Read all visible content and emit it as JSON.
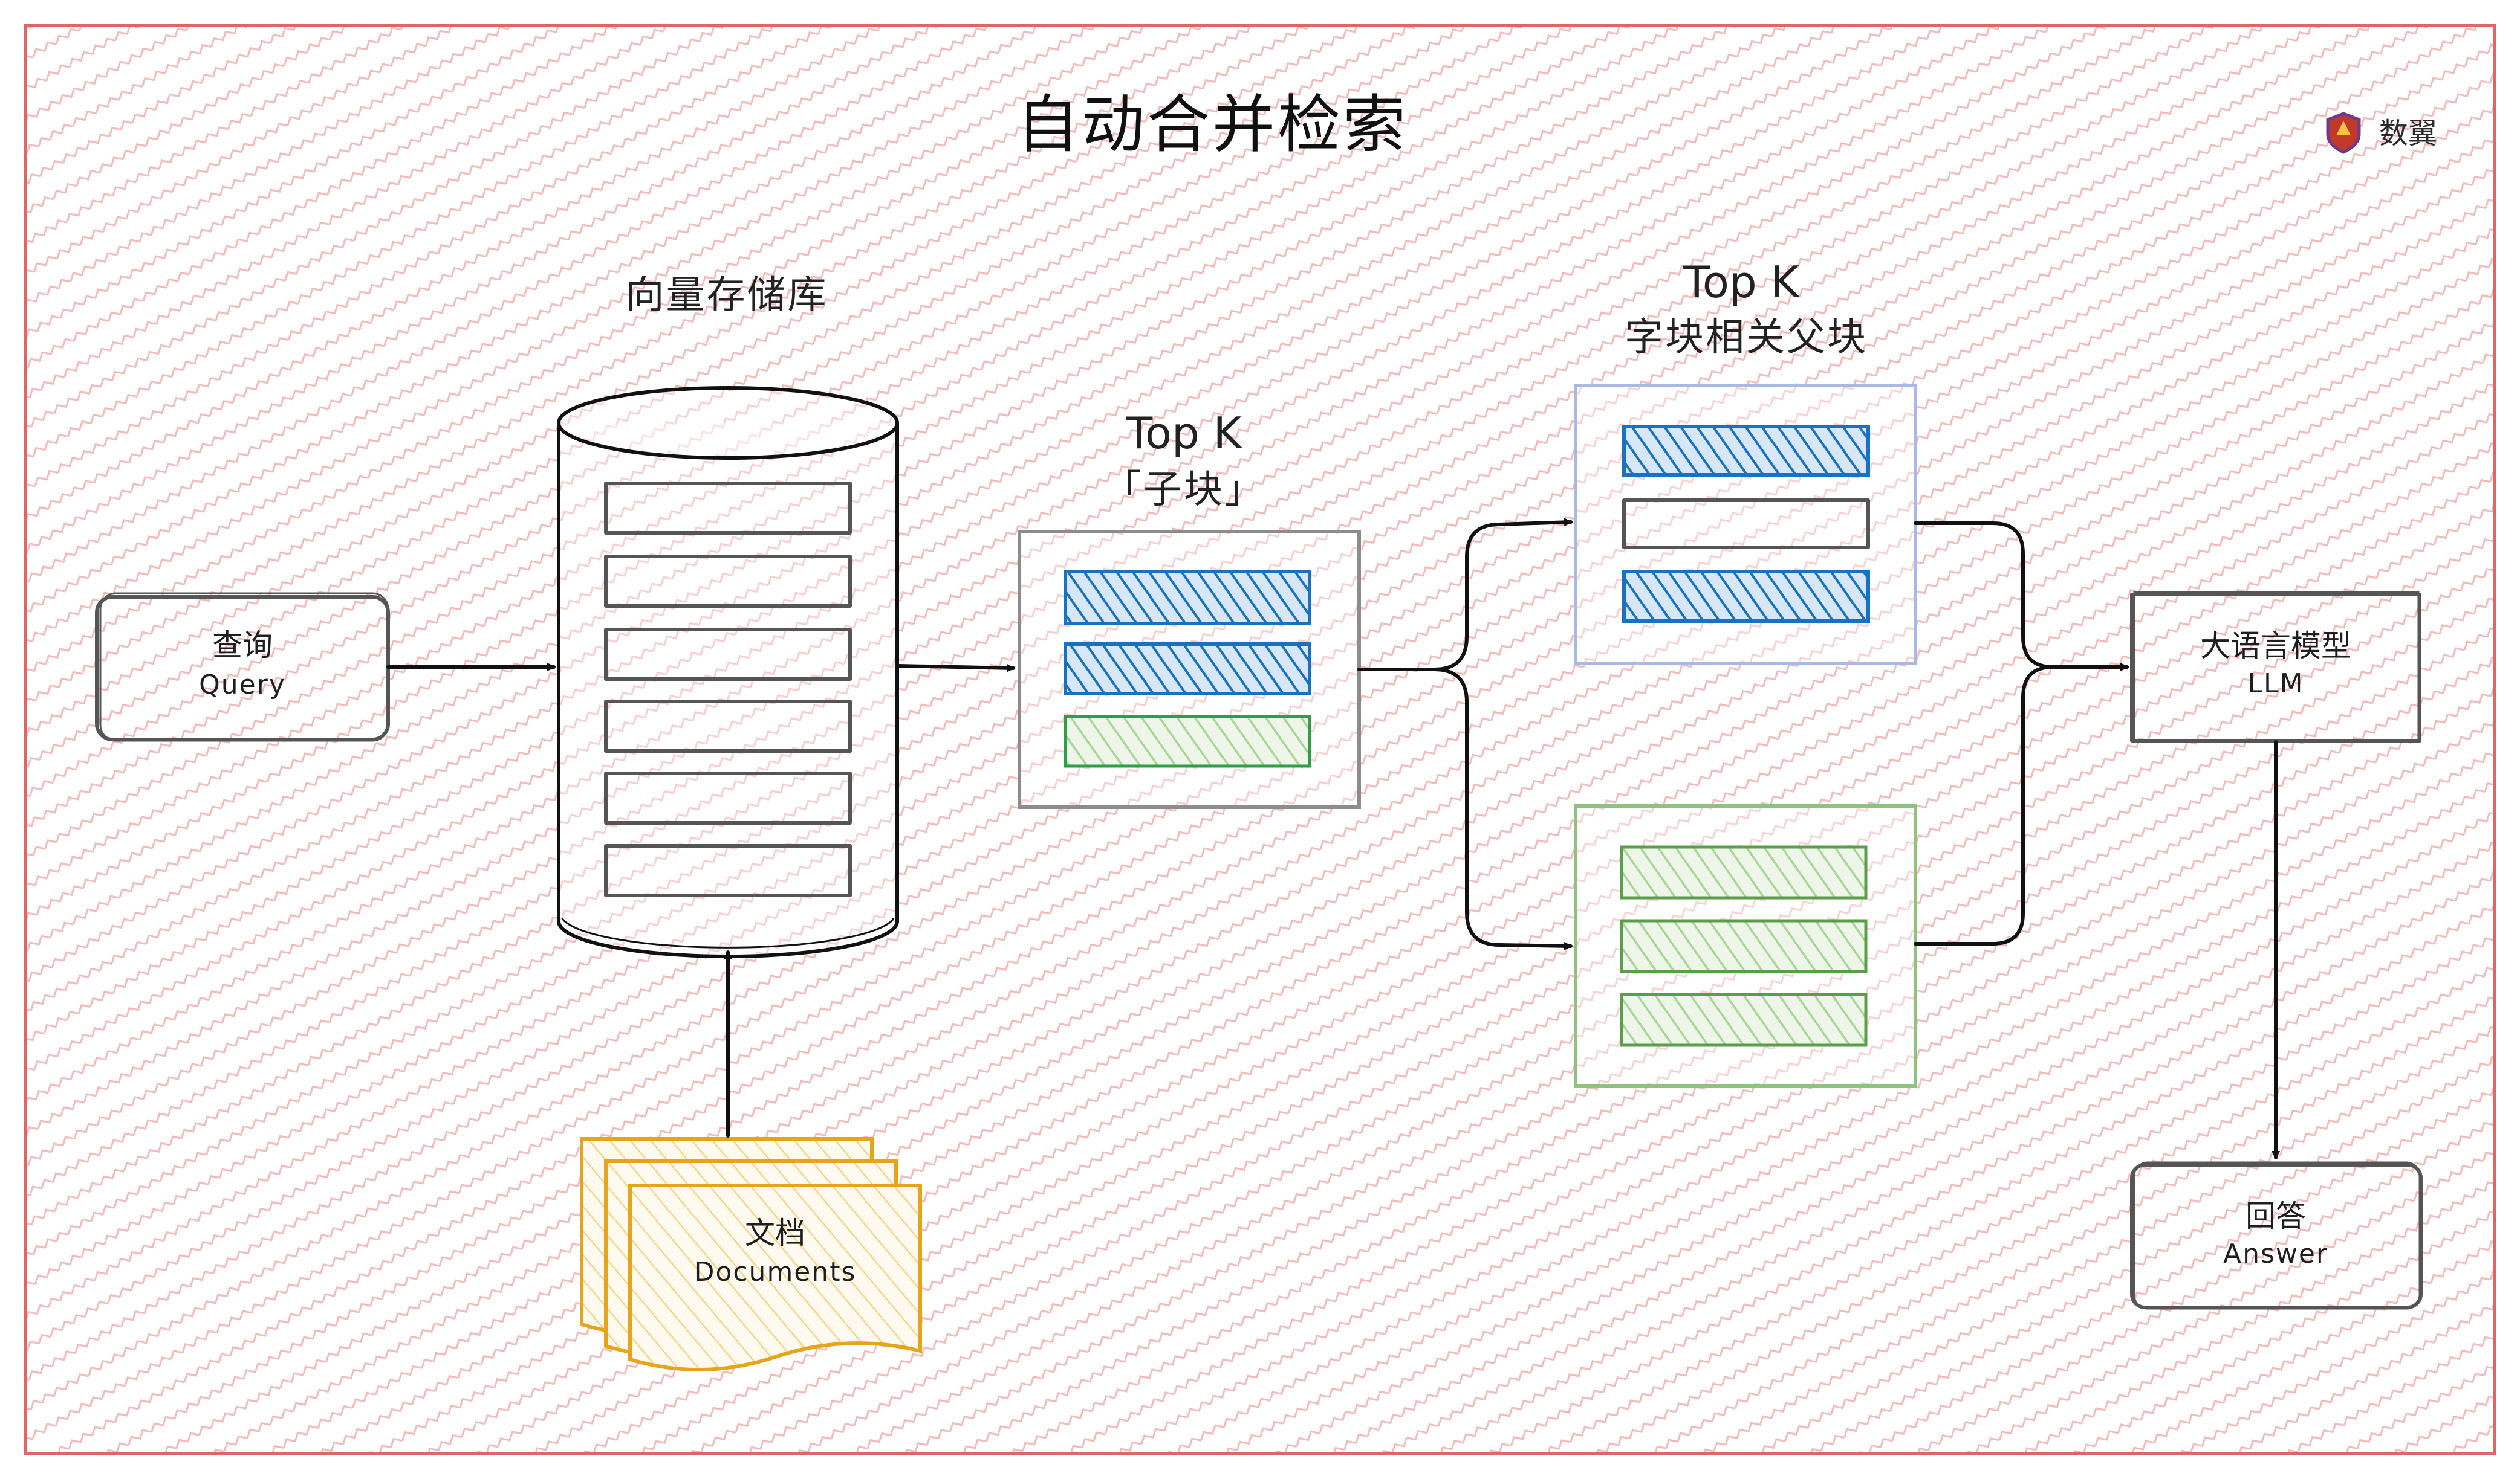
{
  "title": "自动合并检索",
  "brand": {
    "name": "数翼",
    "icon": "shield-logo-icon"
  },
  "colors": {
    "background_pattern": "#f3b9b9",
    "frame": "#e06666",
    "query_box": "#555555",
    "parent_block_blue": "#1971c2",
    "parent_block_blue_border": "#a9b9e6",
    "child_block_blue": "#1971c2",
    "child_block_green": "#2f9e44",
    "parent_block_green_border": "#8fc27e",
    "documents_stroke": "#e8a418"
  },
  "vector_store": {
    "label": "向量存储库"
  },
  "query": {
    "title": "查询",
    "subtitle": "Query"
  },
  "documents": {
    "title": "文档",
    "subtitle": "Documents"
  },
  "child_chunks": {
    "label_top": "Top K",
    "label_bottom": "「子块」"
  },
  "parent_chunks": {
    "label_top": "Top K",
    "label_bottom": "字块相关父块"
  },
  "llm": {
    "title": "大语言模型",
    "subtitle": "LLM"
  },
  "answer": {
    "title": "回答",
    "subtitle": "Answer"
  }
}
